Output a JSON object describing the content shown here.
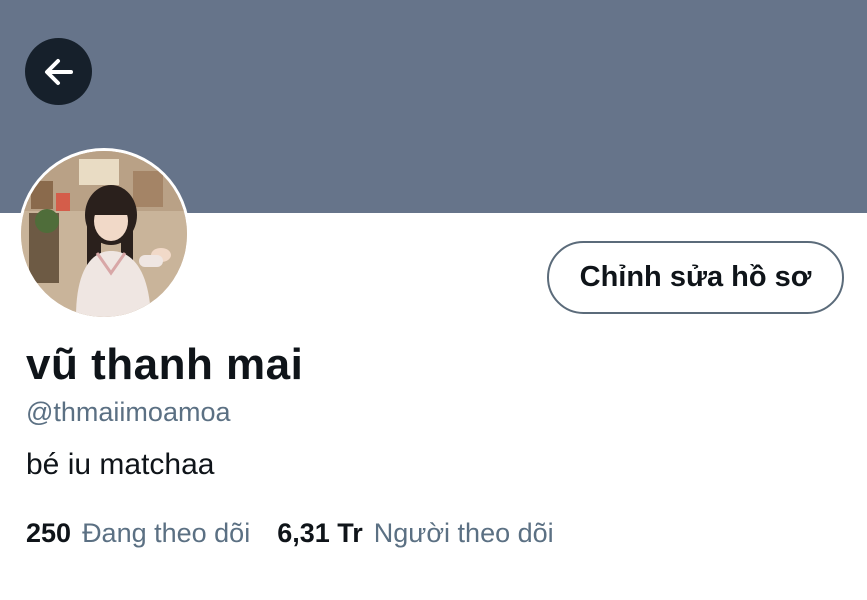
{
  "profile": {
    "name": "vũ thanh mai",
    "handle": "@thmaiimoamoa",
    "bio": "bé iu matchaa",
    "edit_button_label": "Chỉnh sửa hồ sơ",
    "following_count": "250",
    "following_label": "Đang theo dõi",
    "followers_count": "6,31 Tr",
    "followers_label": "Người theo dõi"
  },
  "icons": {
    "back": "arrow-left-icon"
  },
  "colors": {
    "banner": "#66748a",
    "back_button": "#16202b",
    "secondary_text": "#5b7083",
    "primary_text": "#0f1419"
  }
}
